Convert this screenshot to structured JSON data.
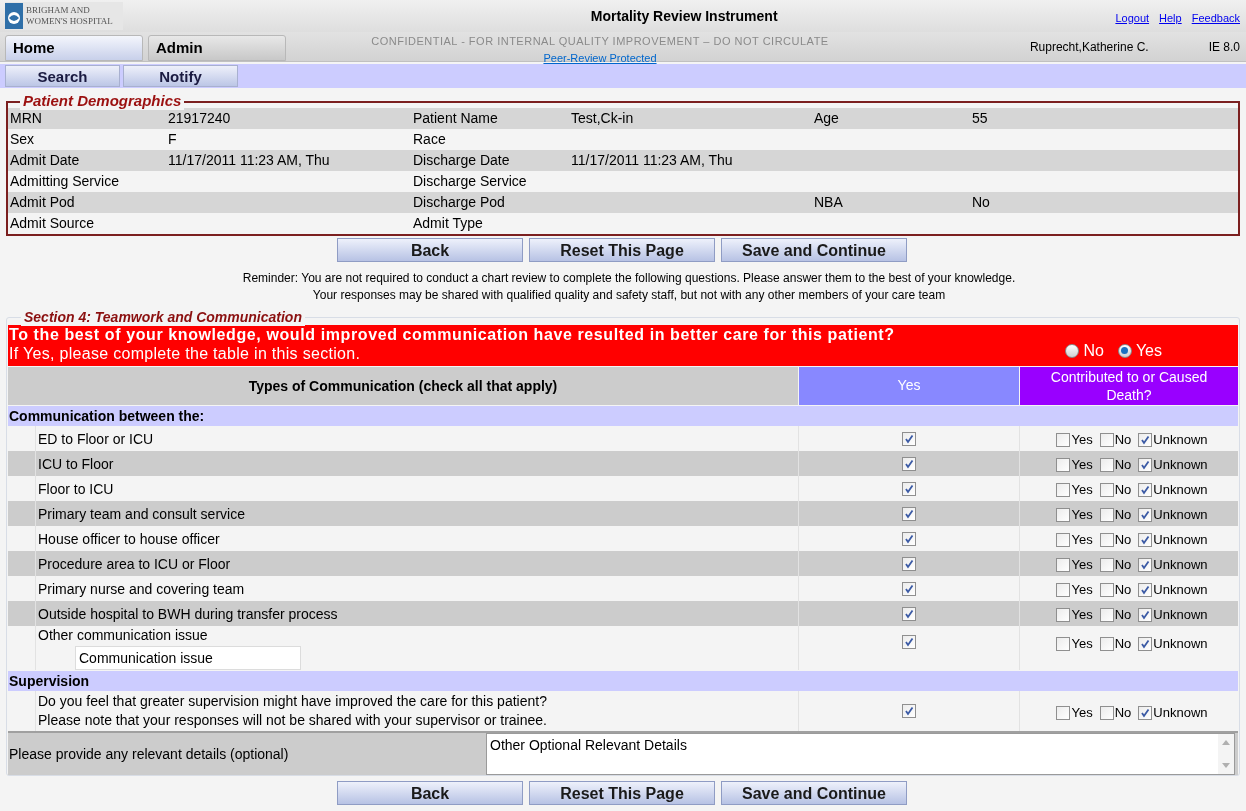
{
  "header": {
    "logo_lines": [
      "BRIGHAM AND",
      "WOMEN'S HOSPITAL"
    ],
    "title": "Mortality Review Instrument",
    "links": [
      "Logout",
      "Help",
      "Feedback"
    ],
    "tabs": [
      {
        "label": "Home",
        "selected": true
      },
      {
        "label": "Admin",
        "selected": false
      }
    ],
    "notice": "CONFIDENTIAL - FOR INTERNAL QUALITY IMPROVEMENT – DO NOT CIRCULATE",
    "notice_link": "Peer-Review Protected",
    "user": "Ruprecht,Katherine C.",
    "version": "IE 8.0"
  },
  "subnav": [
    "Search",
    "Notify"
  ],
  "demographics": {
    "legend": "Patient Demographics",
    "rows": [
      [
        {
          "label": "MRN",
          "value": "21917240"
        },
        {
          "label": "Patient Name",
          "value": "Test,Ck-in"
        },
        {
          "label": "Age",
          "value": "55"
        }
      ],
      [
        {
          "label": "Sex",
          "value": "F"
        },
        {
          "label": "Race"
        }
      ],
      [
        {
          "label": "Admit Date",
          "value": "11/17/2011 11:23 AM, Thu"
        },
        {
          "label": "Discharge Date",
          "value": "11/17/2011 11:23 AM, Thu"
        }
      ],
      [
        {
          "label": "Admitting Service"
        },
        {
          "label": "Discharge Service"
        }
      ],
      [
        {
          "label": "Admit Pod"
        },
        {
          "label": "Discharge Pod"
        },
        {
          "label": "NBA",
          "value": "No"
        }
      ],
      [
        {
          "label": "Admit Source"
        },
        {
          "label": "Admit Type"
        }
      ]
    ]
  },
  "actions": [
    "Back",
    "Reset This Page",
    "Save and Continue"
  ],
  "reminder": [
    "Reminder: You are not required to conduct a chart review to complete the following questions. Please answer them to the best of your knowledge.",
    "Your responses may be shared with qualified quality and safety staff, but not with any other members of your care team"
  ],
  "section": {
    "title": "Section 4: Teamwork and Communication",
    "question": "To the best of your knowledge, would improved communication have resulted in better care for this patient?",
    "note": "If Yes, please complete the table in this section.",
    "options": [
      {
        "label": "No",
        "selected": false
      },
      {
        "label": "Yes",
        "selected": true
      }
    ]
  },
  "table": {
    "columns": [
      "Types of Communication (check all that apply)",
      "Yes",
      "Contributed to or Caused Death?"
    ],
    "groups": [
      {
        "title": "Communication between the:",
        "items": [
          {
            "kind": "plain",
            "label": "ED to Floor or ICU",
            "checked": true,
            "contributed": [
              {
                "label": "Yes",
                "checked": false
              },
              {
                "label": "No",
                "checked": false
              },
              {
                "label": "Unknown",
                "checked": true
              }
            ]
          },
          {
            "kind": "plain",
            "label": "ICU to Floor",
            "checked": true,
            "contributed": [
              {
                "label": "Yes",
                "checked": false
              },
              {
                "label": "No",
                "checked": false
              },
              {
                "label": "Unknown",
                "checked": true
              }
            ]
          },
          {
            "kind": "plain",
            "label": "Floor to ICU",
            "checked": true,
            "contributed": [
              {
                "label": "Yes",
                "checked": false
              },
              {
                "label": "No",
                "checked": false
              },
              {
                "label": "Unknown",
                "checked": true
              }
            ]
          },
          {
            "kind": "plain",
            "label": "Primary team and consult service",
            "checked": true,
            "contributed": [
              {
                "label": "Yes",
                "checked": false
              },
              {
                "label": "No",
                "checked": false
              },
              {
                "label": "Unknown",
                "checked": true
              }
            ]
          },
          {
            "kind": "plain",
            "label": "House officer to house officer",
            "checked": true,
            "contributed": [
              {
                "label": "Yes",
                "checked": false
              },
              {
                "label": "No",
                "checked": false
              },
              {
                "label": "Unknown",
                "checked": true
              }
            ]
          },
          {
            "kind": "plain",
            "label": "Procedure area to ICU or Floor",
            "checked": true,
            "contributed": [
              {
                "label": "Yes",
                "checked": false
              },
              {
                "label": "No",
                "checked": false
              },
              {
                "label": "Unknown",
                "checked": true
              }
            ]
          },
          {
            "kind": "plain",
            "label": "Primary nurse and covering team",
            "checked": true,
            "contributed": [
              {
                "label": "Yes",
                "checked": false
              },
              {
                "label": "No",
                "checked": false
              },
              {
                "label": "Unknown",
                "checked": true
              }
            ]
          },
          {
            "kind": "plain",
            "label": "Outside hospital to BWH during transfer process",
            "checked": true,
            "contributed": [
              {
                "label": "Yes",
                "checked": false
              },
              {
                "label": "No",
                "checked": false
              },
              {
                "label": "Unknown",
                "checked": true
              }
            ]
          },
          {
            "kind": "other",
            "label": "Other communication issue",
            "value": "Communication issue",
            "checked": true,
            "contributed": [
              {
                "label": "Yes",
                "checked": false
              },
              {
                "label": "No",
                "checked": false
              },
              {
                "label": "Unknown",
                "checked": true
              }
            ]
          }
        ]
      },
      {
        "title": "Supervision",
        "items": [
          {
            "kind": "question",
            "lines": [
              "Do you feel that greater supervision might have improved the care for this patient?",
              "Please note that your responses will not be shared with your supervisor or trainee."
            ],
            "checked": true,
            "contributed": [
              {
                "label": "Yes",
                "checked": false
              },
              {
                "label": "No",
                "checked": false
              },
              {
                "label": "Unknown",
                "checked": true
              }
            ]
          }
        ]
      }
    ]
  },
  "details": {
    "label": "Please provide any relevant details (optional)",
    "value": "Other Optional Relevant Details"
  },
  "bottom_actions": [
    "Back",
    "Reset This Page",
    "Save and Continue"
  ]
}
